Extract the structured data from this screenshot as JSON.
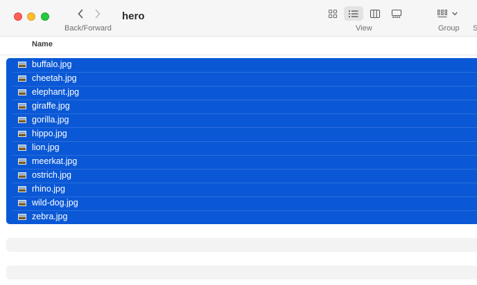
{
  "window": {
    "title": "hero"
  },
  "toolbar": {
    "back_forward_label": "Back/Forward",
    "view_label": "View",
    "group_label": "Group",
    "share_label_partial": "S",
    "icons": {
      "back": "chevron-left-icon",
      "forward": "chevron-right-icon",
      "view_icons": "grid-icon",
      "view_list": "list-icon",
      "view_columns": "columns-icon",
      "view_gallery": "gallery-icon",
      "group": "group-icon",
      "group_menu": "chevron-down-icon"
    },
    "selected_view": "list"
  },
  "columns": {
    "name_header": "Name"
  },
  "files": [
    {
      "name": "buffalo.jpg"
    },
    {
      "name": "cheetah.jpg"
    },
    {
      "name": "elephant.jpg"
    },
    {
      "name": "giraffe.jpg"
    },
    {
      "name": "gorilla.jpg"
    },
    {
      "name": "hippo.jpg"
    },
    {
      "name": "lion.jpg"
    },
    {
      "name": "meerkat.jpg"
    },
    {
      "name": "ostrich.jpg"
    },
    {
      "name": "rhino.jpg"
    },
    {
      "name": "wild-dog.jpg"
    },
    {
      "name": "zebra.jpg"
    }
  ],
  "selection": {
    "all_selected": true,
    "highlight_color": "#0a58d6"
  },
  "colors": {
    "close": "#fe5f57",
    "minimize": "#febc2e",
    "zoom": "#28c840",
    "toolbar_bg": "#f6f6f6",
    "stripe": "#f3f3f3"
  }
}
